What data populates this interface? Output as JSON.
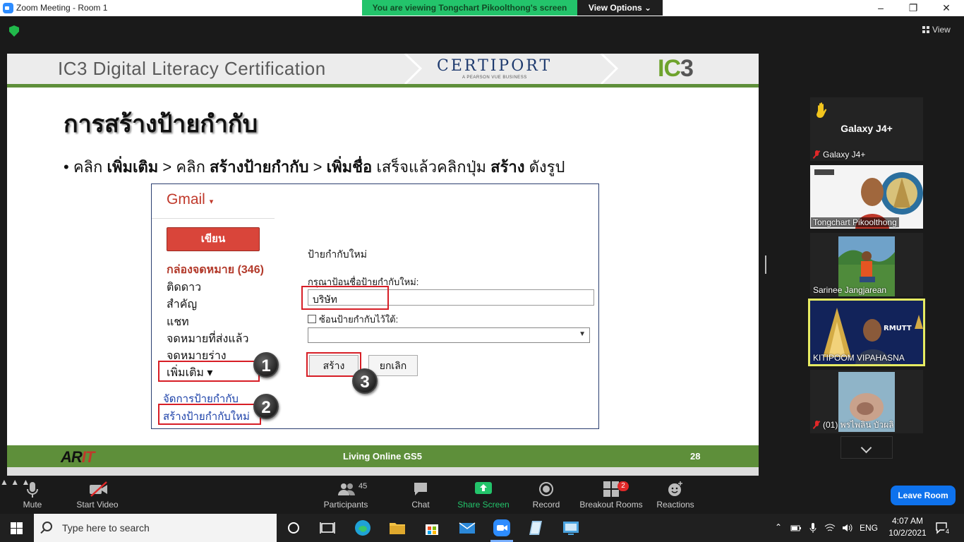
{
  "window": {
    "title": "Zoom Meeting - Room 1",
    "minimize": "–",
    "restore": "❐",
    "close": "✕"
  },
  "share_banner": {
    "text": "You are viewing Tongchart Pikoolthong's screen",
    "view_options": "View Options ⌄"
  },
  "top_view_btn": "View",
  "slide": {
    "header_title": "IC3 Digital Literacy Certification",
    "certiport": "CERTIPORT",
    "certiport_sub": "A PEARSON VUE BUSINESS",
    "ic3_logo_a": "IC",
    "ic3_logo_b": "3",
    "title": "การสร้างป้ายกำกับ",
    "bullet": {
      "b1": "• คลิก ",
      "b2": "เพิ่มเติม",
      "b3": " > คลิก ",
      "b4": "สร้างป้ายกำกับ",
      "b5": " > ",
      "b6": "เพิ่มชื่อ",
      "b7": " เสร็จแล้วคลิกปุ่ม ",
      "b8": "สร้าง",
      "b9": " ดังรูป"
    },
    "gmail": {
      "logo": "Gmail",
      "caret": "▾",
      "compose": "เขียน",
      "nav": [
        "กล่องจดหมาย (346)",
        "ติดดาว",
        "สำคัญ",
        "แชท",
        "จดหมายที่ส่งแล้ว",
        "จดหมายร่าง",
        "เพิ่มเติม ▾"
      ],
      "manage_labels": "จัดการป้ายกำกับ",
      "create_label": "สร้างป้ายกำกับใหม่",
      "new_label_title": "ป้ายกำกับใหม่",
      "new_label_prompt": "กรุณาป้อนชื่อป้ายกำกับใหม่:",
      "name_value": "บริษัท",
      "nest_label": "ซ้อนป้ายกำกับไว้ใต้:",
      "create_btn": "สร้าง",
      "cancel_btn": "ยกเลิก",
      "badges": [
        "1",
        "2",
        "3"
      ]
    },
    "footer_logo_a": "AR",
    "footer_logo_b": "IT",
    "footer_text": "Living Online GS5",
    "page_num": "28"
  },
  "participants": [
    {
      "name": "Galaxy J4+",
      "sub": "Galaxy J4+",
      "hand": true,
      "muted": true
    },
    {
      "name": "Tongchart Pikoolthong",
      "muted": false
    },
    {
      "name": "Sarinee Jangjarean",
      "muted": false
    },
    {
      "name": "KITIPOOM VIPAHASNA",
      "muted": false,
      "active": true
    },
    {
      "name": "(01) พรไพลิน บัวผลิ",
      "muted": true
    }
  ],
  "tile_texts": {
    "rmutt": "RMUTT"
  },
  "toolbar": {
    "mute": "Mute",
    "start_video": "Start Video",
    "participants": "Participants",
    "participants_count": "45",
    "chat": "Chat",
    "share_screen": "Share Screen",
    "record": "Record",
    "breakout": "Breakout Rooms",
    "breakout_count": "2",
    "reactions": "Reactions",
    "leave": "Leave Room"
  },
  "taskbar": {
    "search_placeholder": "Type here to search",
    "lang": "ENG",
    "time": "4:07 AM",
    "date": "10/2/2021",
    "notif_count": "4"
  },
  "colors": {
    "zoom_blue": "#0e72ed",
    "banner_green": "#23c46b",
    "slide_green": "#5e8f3a",
    "highlight_red": "#d71e26"
  }
}
